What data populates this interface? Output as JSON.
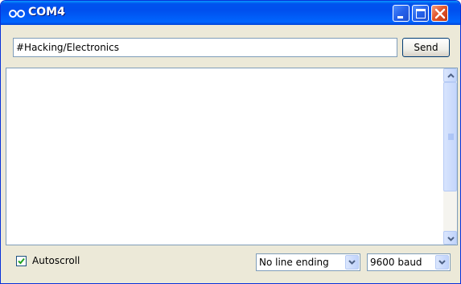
{
  "window": {
    "title": "COM4",
    "title_icon": "arduino-infinity-icon",
    "controls": [
      "minimize-icon",
      "maximize-icon",
      "close-icon"
    ]
  },
  "input": {
    "value": "#Hacking/Electronics"
  },
  "send_button": {
    "label": "Send"
  },
  "output": {
    "text": ""
  },
  "bottom": {
    "autoscroll_label": "Autoscroll",
    "autoscroll_checked": true,
    "line_ending": {
      "selected": "No line ending"
    },
    "baud_rate": {
      "selected": "9600 baud"
    }
  },
  "colors": {
    "titlebar": "#0054e3",
    "close_button": "#e2562d",
    "window_face": "#ece9d8",
    "input_border": "#7f9db9"
  }
}
